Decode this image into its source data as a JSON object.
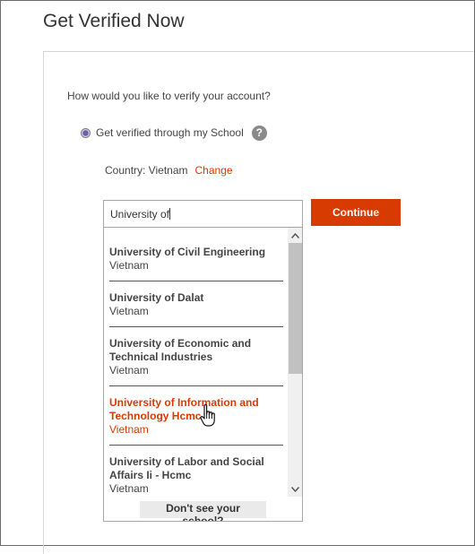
{
  "header": {
    "title": "Get Verified Now"
  },
  "form": {
    "question": "How would you like to verify your account?",
    "option_label": "Get verified through my School",
    "help_glyph": "?",
    "country_text": "Country: Vietnam",
    "change_label": "Change",
    "search_value": "University of",
    "continue_label": "Continue"
  },
  "dropdown": {
    "items": [
      {
        "name": "University of Civil Engineering",
        "country": "Vietnam"
      },
      {
        "name": "University of Dalat",
        "country": "Vietnam"
      },
      {
        "name": "University of Economic and Technical Industries",
        "country": "Vietnam"
      },
      {
        "name": "University of Information and Technology Hcmc V",
        "country": "Vietnam"
      },
      {
        "name": "University of Labor and Social Affairs Ii - Hcmc",
        "country": "Vietnam"
      }
    ],
    "highlighted_index": 3,
    "dont_see_label": "Don't see your school?"
  },
  "colors": {
    "accent": "#d83b01",
    "scroll_thumb": "#c1c1c1"
  },
  "icons": [
    "help-icon",
    "scroll-up-arrow-icon",
    "scroll-down-arrow-icon",
    "hand-pointer-cursor-icon"
  ]
}
